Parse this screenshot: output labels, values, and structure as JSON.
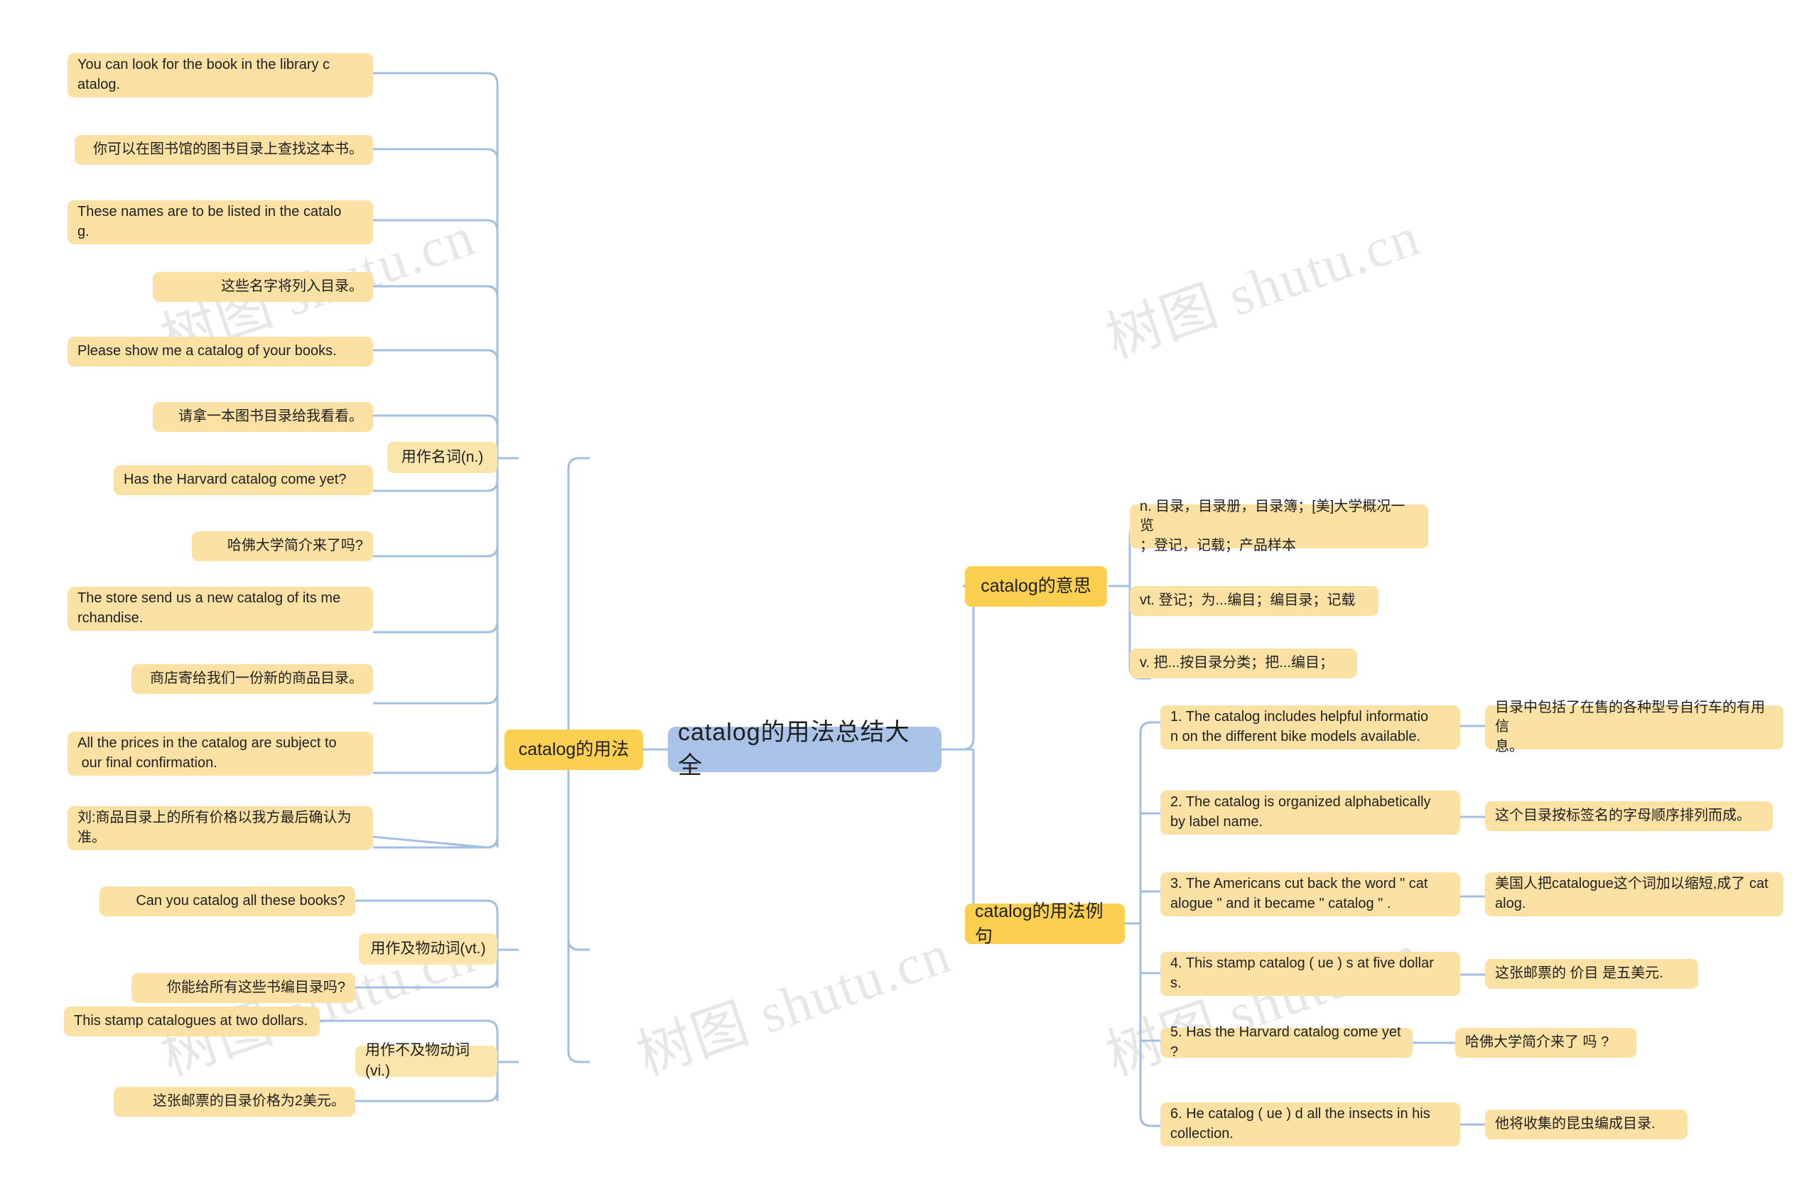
{
  "meta": {
    "watermark_text": "树图 shutu.cn",
    "colors": {
      "root_fill": "#a8c2e8",
      "branch_fill": "#fbcf4f",
      "category_fill": "#fce5ab",
      "leaf_fill": "#fbe2a4",
      "connector": "#a3bfe0",
      "text": "#1f1f1f",
      "background": "#ffffff"
    }
  },
  "root": {
    "label": "catalog的用法总结大全"
  },
  "branches": {
    "usage": {
      "label": "catalog的用法"
    },
    "meaning": {
      "label": "catalog的意思"
    },
    "examples": {
      "label": "catalog的用法例句"
    }
  },
  "categories": {
    "noun": {
      "label": "用作名词(n.)"
    },
    "vt": {
      "label": "用作及物动词(vt.)"
    },
    "vi": {
      "label": "用作不及物动词(vi.)"
    }
  },
  "noun_examples": [
    {
      "en": "You can look for the book in the library c\natalog.",
      "zh": "你可以在图书馆的图书目录上查找这本书。"
    },
    {
      "en": "These names are to be listed in the catalo\ng.",
      "zh": "这些名字将列入目录。"
    },
    {
      "en": "Please show me a catalog of your books.",
      "zh": "请拿一本图书目录给我看看。"
    },
    {
      "en": "Has the Harvard catalog come yet?",
      "zh": "哈佛大学简介来了吗?"
    },
    {
      "en": "The store send us a new catalog of its me\nrchandise.",
      "zh": "商店寄给我们一份新的商品目录。"
    },
    {
      "en": "All the prices in the catalog are subject to\n our final confirmation.",
      "zh": "刘:商品目录上的所有价格以我方最后确认为\n准。"
    }
  ],
  "vt_examples": [
    {
      "en": "Can you catalog all these books?",
      "zh": "你能给所有这些书编目录吗?"
    }
  ],
  "vi_examples": [
    {
      "en": "This stamp catalogues at two dollars.",
      "zh": "这张邮票的目录价格为2美元。"
    }
  ],
  "meanings": [
    {
      "text": "n. 目录，目录册，目录簿；[美]大学概况一览\n；登记，记载；产品样本"
    },
    {
      "text": "vt. 登记；为...编目；编目录；记载"
    },
    {
      "text": "v. 把...按目录分类；把...编目；"
    }
  ],
  "example_sentences": [
    {
      "en": "1. The catalog includes helpful informatio\nn on the different bike models available.",
      "zh": "目录中包括了在售的各种型号自行车的有用信\n息。"
    },
    {
      "en": "2. The catalog is organized alphabetically\nby label name.",
      "zh": "这个目录按标签名的字母顺序排列而成。"
    },
    {
      "en": "3. The Americans cut back the word \" cat\nalogue \" and it became \" catalog \" .",
      "zh": "美国人把catalogue这个词加以缩短,成了 cat\nalog."
    },
    {
      "en": "4. This stamp catalog ( ue ) s at five dollar\ns.",
      "zh": "这张邮票的 价目 是五美元."
    },
    {
      "en": "5. Has the Harvard catalog come yet ?",
      "zh": "哈佛大学简介来了 吗 ?"
    },
    {
      "en": "6. He catalog ( ue ) d all the insects in his\ncollection.",
      "zh": "他将收集的昆虫编成目录."
    }
  ]
}
